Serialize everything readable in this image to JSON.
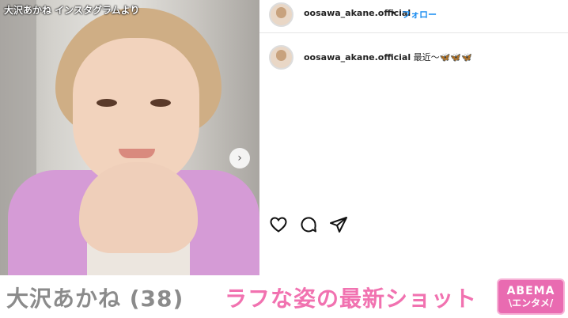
{
  "photo": {
    "watermark": "大沢あかね インスタグラムより",
    "next_icon": "chevron-right-icon"
  },
  "post": {
    "username": "oosawa_akane.official",
    "separator": "•",
    "follow_label": "フォロー",
    "caption_user": "oosawa_akane.official",
    "caption_text": " 最近〜",
    "caption_emoji": "🦋🦋🦋"
  },
  "actions": {
    "like_icon": "heart-icon",
    "comment_icon": "comment-icon",
    "share_icon": "share-icon"
  },
  "caption_bar": {
    "name": "大沢あかね (38)",
    "headline": "ラフな姿の最新ショット"
  },
  "logo": {
    "line1": "ABEMA",
    "line2": "\\エンタメ/"
  },
  "colors": {
    "accent_pink": "#f172b0",
    "logo_pink": "#e96bb1",
    "follow_blue": "#1a8cf0",
    "gray_text": "#8b8b8b"
  }
}
